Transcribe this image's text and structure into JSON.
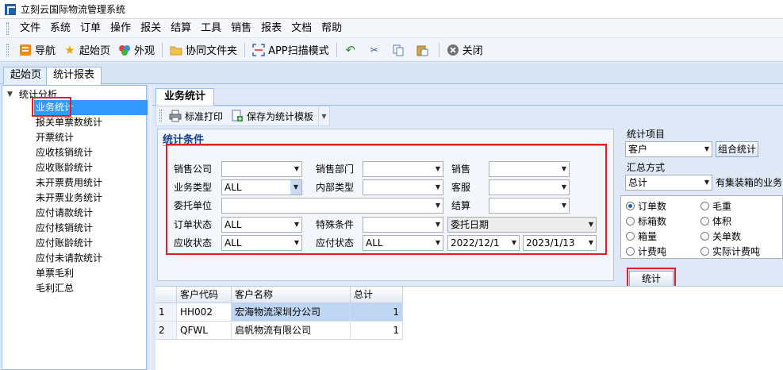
{
  "window": {
    "title": "立刻云国际物流管理系统"
  },
  "menu": [
    "文件",
    "系统",
    "订单",
    "操作",
    "报关",
    "结算",
    "工具",
    "销售",
    "报表",
    "文档",
    "帮助"
  ],
  "toolbar": {
    "nav": "导航",
    "home": "起始页",
    "appearance": "外观",
    "shared_folder": "协同文件夹",
    "app_scan": "APP扫描模式",
    "close": "关闭"
  },
  "tabs": [
    "起始页",
    "统计报表"
  ],
  "tree": {
    "root": "统计分析",
    "items": [
      "业务统计",
      "报关单票数统计",
      "开票统计",
      "应收核销统计",
      "应收账龄统计",
      "未开票费用统计",
      "未开票业务统计",
      "应付请款统计",
      "应付核销统计",
      "应付账龄统计",
      "应付未请款统计",
      "单票毛利",
      "毛利汇总"
    ]
  },
  "inner_tab": "业务统计",
  "subtoolbar": {
    "print": "标准打印",
    "save_template": "保存为统计模板"
  },
  "conditions": {
    "title": "统计条件",
    "sales_company": "销售公司",
    "sales_dept": "销售部门",
    "salesperson": "销售",
    "biz_type": "业务类型",
    "biz_type_value": "ALL",
    "internal_type": "内部类型",
    "customer_service": "客服",
    "client": "委托单位",
    "settlement": "结算",
    "order_status": "订单状态",
    "order_status_value": "ALL",
    "special": "特殊条件",
    "date_type_value": "委托日期",
    "ar_status": "应收状态",
    "ar_status_value": "ALL",
    "ap_status": "应付状态",
    "ap_status_value": "ALL",
    "date_from": "2022/12/1",
    "date_to": "2023/1/13"
  },
  "side": {
    "stat_item_label": "统计项目",
    "stat_item_value": "客户",
    "combo_button": "组合统计",
    "summary_label": "汇总方式",
    "summary_value": "总计",
    "container_text": "有集装箱的业务",
    "radios": [
      {
        "label": "订单数",
        "checked": true
      },
      {
        "label": "毛重",
        "checked": false
      },
      {
        "label": "标箱数",
        "checked": false
      },
      {
        "label": "体积",
        "checked": false
      },
      {
        "label": "箱量",
        "checked": false
      },
      {
        "label": "关单数",
        "checked": false
      },
      {
        "label": "计费吨",
        "checked": false
      },
      {
        "label": "实际计费吨",
        "checked": false
      }
    ],
    "stat_button": "统计"
  },
  "table": {
    "columns": [
      "客户代码",
      "客户名称",
      "总计"
    ],
    "rows": [
      {
        "n": "1",
        "code": "HH002",
        "name": "宏海物流深圳分公司",
        "total": "1"
      },
      {
        "n": "2",
        "code": "QFWL",
        "name": "启帆物流有限公司",
        "total": "1"
      }
    ]
  }
}
